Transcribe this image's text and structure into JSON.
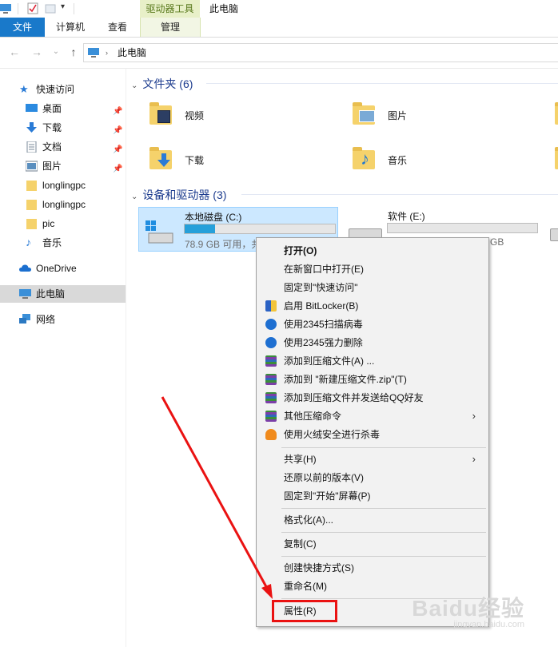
{
  "window": {
    "ribbon_context": "驱动器工具",
    "title": "此电脑"
  },
  "tabs": [
    "文件",
    "计算机",
    "查看",
    "管理"
  ],
  "address": {
    "path": "此电脑"
  },
  "sidebar": {
    "quick_access": "快速访问",
    "items": [
      {
        "label": "桌面",
        "icon": "desktop-icon"
      },
      {
        "label": "下载",
        "icon": "download-icon"
      },
      {
        "label": "文档",
        "icon": "document-icon"
      },
      {
        "label": "图片",
        "icon": "picture-icon"
      },
      {
        "label": "longlingpc",
        "icon": "folder-icon"
      },
      {
        "label": "longlingpc",
        "icon": "folder-icon"
      },
      {
        "label": "pic",
        "icon": "folder-icon"
      },
      {
        "label": "音乐",
        "icon": "music-icon"
      }
    ],
    "onedrive": "OneDrive",
    "this_pc": "此电脑",
    "network": "网络"
  },
  "folders": {
    "header": "文件夹 (6)",
    "items": [
      "视频",
      "图片",
      "下载",
      "音乐"
    ]
  },
  "devices": {
    "header": "设备和驱动器 (3)",
    "drive_c": {
      "name": "本地磁盘 (C:)",
      "free": "78.9 GB 可用，共",
      "used_fraction": 0.2
    },
    "drive_e": {
      "name": "软件 (E:)",
      "size_tail": "GB",
      "used_fraction": 0.0
    }
  },
  "context_menu": {
    "items": [
      "打开(O)",
      "在新窗口中打开(E)",
      "固定到\"快速访问\"",
      "启用 BitLocker(B)",
      "使用2345扫描病毒",
      "使用2345强力删除",
      "添加到压缩文件(A) ...",
      "添加到 \"新建压缩文件.zip\"(T)",
      "添加到压缩文件并发送给QQ好友",
      "其他压缩命令",
      "使用火绒安全进行杀毒",
      "共享(H)",
      "还原以前的版本(V)",
      "固定到\"开始\"屏幕(P)",
      "格式化(A)...",
      "复制(C)",
      "创建快捷方式(S)",
      "重命名(M)",
      "属性(R)"
    ]
  },
  "watermark": {
    "text": "Baidu经验",
    "sub": "jingyan.baidu.com"
  },
  "colors": {
    "accent": "#1979ca",
    "highlight": "#ea1212",
    "drive_fill": "#26a0da"
  }
}
